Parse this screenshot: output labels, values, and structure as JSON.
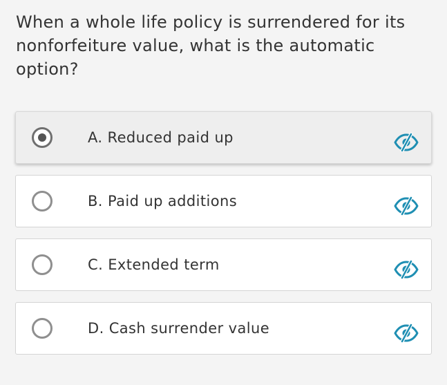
{
  "question": {
    "text": "When a whole life policy is surrendered for its nonforfeiture value, what is the automatic option?"
  },
  "options": [
    {
      "label": "A. Reduced paid up",
      "selected": true
    },
    {
      "label": "B. Paid up additions",
      "selected": false
    },
    {
      "label": "C. Extended term",
      "selected": false
    },
    {
      "label": "D. Cash surrender value",
      "selected": false
    }
  ],
  "icons": {
    "radio": "radio-button-icon",
    "hide_option": "eye-slash-icon"
  },
  "colors": {
    "background": "#f4f4f4",
    "card": "#ffffff",
    "selected_card": "#eeeeee",
    "accent": "#1f8fb3",
    "text": "#333333"
  }
}
